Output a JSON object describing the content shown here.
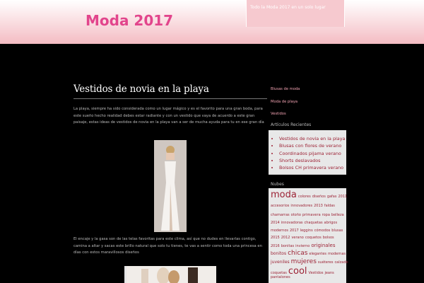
{
  "site": {
    "title": "Moda 2017",
    "tagline": "Todo la Moda 2017 en un solo lugar"
  },
  "post": {
    "title": "Vestidos de novia en la playa",
    "paragraph1": "La playa, siempre ha sido considerada como un lugar mágico y es el favorito para una gran boda, para este sueño hecho realidad debes estar radiante y con un vestido que vaya de acuerdo a este gran paisaje, estas ideas de vestidos de novia en la playa van a ser de mucha ayuda para tu en ese gran día",
    "paragraph2": "El encaje y la gasa son de las telas favoritas para este clima, así que no dudes en llevarlas contigo, camina a altar y sacas este brillo natural que solo tu tienes, te vas a sentir como toda una princesa en días con estos maravillosos diseños"
  },
  "sidebar": {
    "menu": [
      "Blusas de moda",
      "Moda de playa",
      "Vestidos"
    ],
    "recent_title": "Artículos Recientes",
    "recent": [
      "Vestidos de novia en la playa",
      "Blusas con flores de verano",
      "Coordinados pijama verano",
      "Shorts deslavados",
      "Bolsos CH primavera verano"
    ],
    "tags_title": "Nubes",
    "tag_lines": [
      [
        {
          "t": "moda",
          "s": 13
        },
        {
          "t": "colores",
          "s": 5
        },
        {
          "t": "diseños",
          "s": 5
        },
        {
          "t": "gafas",
          "s": 5
        },
        {
          "t": "2011",
          "s": 5
        }
      ],
      [
        {
          "t": "accesorios",
          "s": 5
        },
        {
          "t": "innovadores",
          "s": 5
        },
        {
          "t": "2013",
          "s": 5
        },
        {
          "t": "faldas",
          "s": 5
        }
      ],
      [
        {
          "t": "chamarras",
          "s": 5
        },
        {
          "t": "otoño",
          "s": 5
        },
        {
          "t": "primavera",
          "s": 5
        },
        {
          "t": "ropa",
          "s": 5
        },
        {
          "t": "belleza",
          "s": 5
        }
      ],
      [
        {
          "t": "2014",
          "s": 5
        },
        {
          "t": "innovadoras",
          "s": 5
        },
        {
          "t": "chaquetas",
          "s": 5
        },
        {
          "t": "abrigos",
          "s": 5
        }
      ],
      [
        {
          "t": "modernos",
          "s": 5
        },
        {
          "t": "2017",
          "s": 5
        },
        {
          "t": "leggins",
          "s": 5
        },
        {
          "t": "cómodos",
          "s": 5
        },
        {
          "t": "blusas",
          "s": 5
        }
      ],
      [
        {
          "t": "2015",
          "s": 5
        },
        {
          "t": "2012",
          "s": 5
        },
        {
          "t": "verano",
          "s": 5
        },
        {
          "t": "coquetos",
          "s": 5
        },
        {
          "t": "bolsos",
          "s": 5
        }
      ],
      [
        {
          "t": "2016",
          "s": 5
        },
        {
          "t": "bonitas",
          "s": 5
        },
        {
          "t": "invierno",
          "s": 5
        },
        {
          "t": "originales",
          "s": 7
        }
      ],
      [
        {
          "t": "bonitos",
          "s": 6
        },
        {
          "t": "chicas",
          "s": 9
        },
        {
          "t": "elegantes",
          "s": 5
        },
        {
          "t": "modernas",
          "s": 5
        }
      ],
      [
        {
          "t": "juveniles",
          "s": 6
        },
        {
          "t": "mujeres",
          "s": 9
        },
        {
          "t": "suéteres",
          "s": 5
        },
        {
          "t": "calzado",
          "s": 5
        }
      ],
      [
        {
          "t": "coquetas",
          "s": 5
        },
        {
          "t": "cool",
          "s": 13
        },
        {
          "t": "Vestidos",
          "s": 5
        },
        {
          "t": "jeans",
          "s": 5
        }
      ],
      [
        {
          "t": "pantalones",
          "s": 5
        }
      ]
    ]
  },
  "colors": {
    "brand": "#e2458c",
    "link": "#9c2235",
    "menu": "#f3a3b3"
  }
}
